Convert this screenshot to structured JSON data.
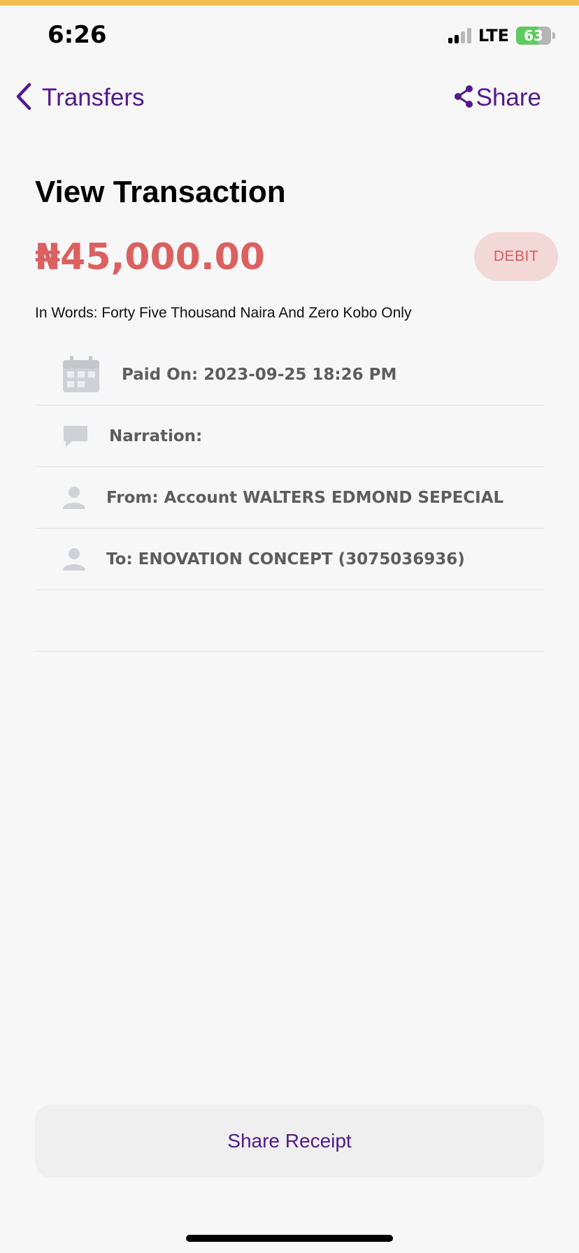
{
  "status_bar": {
    "time": "6:26",
    "network": "LTE",
    "battery_percent": "63",
    "battery_level": 0.63,
    "signal_bars_active": 2,
    "signal_bars_total": 4
  },
  "nav": {
    "back_label": "Transfers",
    "share_label": "Share",
    "back_icon": "chevron-left-icon",
    "share_icon": "share-icon"
  },
  "transaction": {
    "title": "View Transaction",
    "amount": "₦45,000.00",
    "type_badge": "DEBIT",
    "in_words": "In Words: Forty Five Thousand Naira And Zero Kobo Only"
  },
  "details": {
    "paid_on": "Paid On: 2023-09-25 18:26 PM",
    "narration": "Narration:",
    "from": "From: Account WALTERS EDMOND SEPECIAL",
    "to": "To: ENOVATION CONCEPT  (3075036936)"
  },
  "actions": {
    "share_receipt": "Share Receipt"
  },
  "colors": {
    "accent": "#52198c",
    "debit": "#db6060",
    "debit_badge_bg": "#f3d8d8",
    "top_strip": "#f5bd4f",
    "battery": "#5fca5f"
  }
}
